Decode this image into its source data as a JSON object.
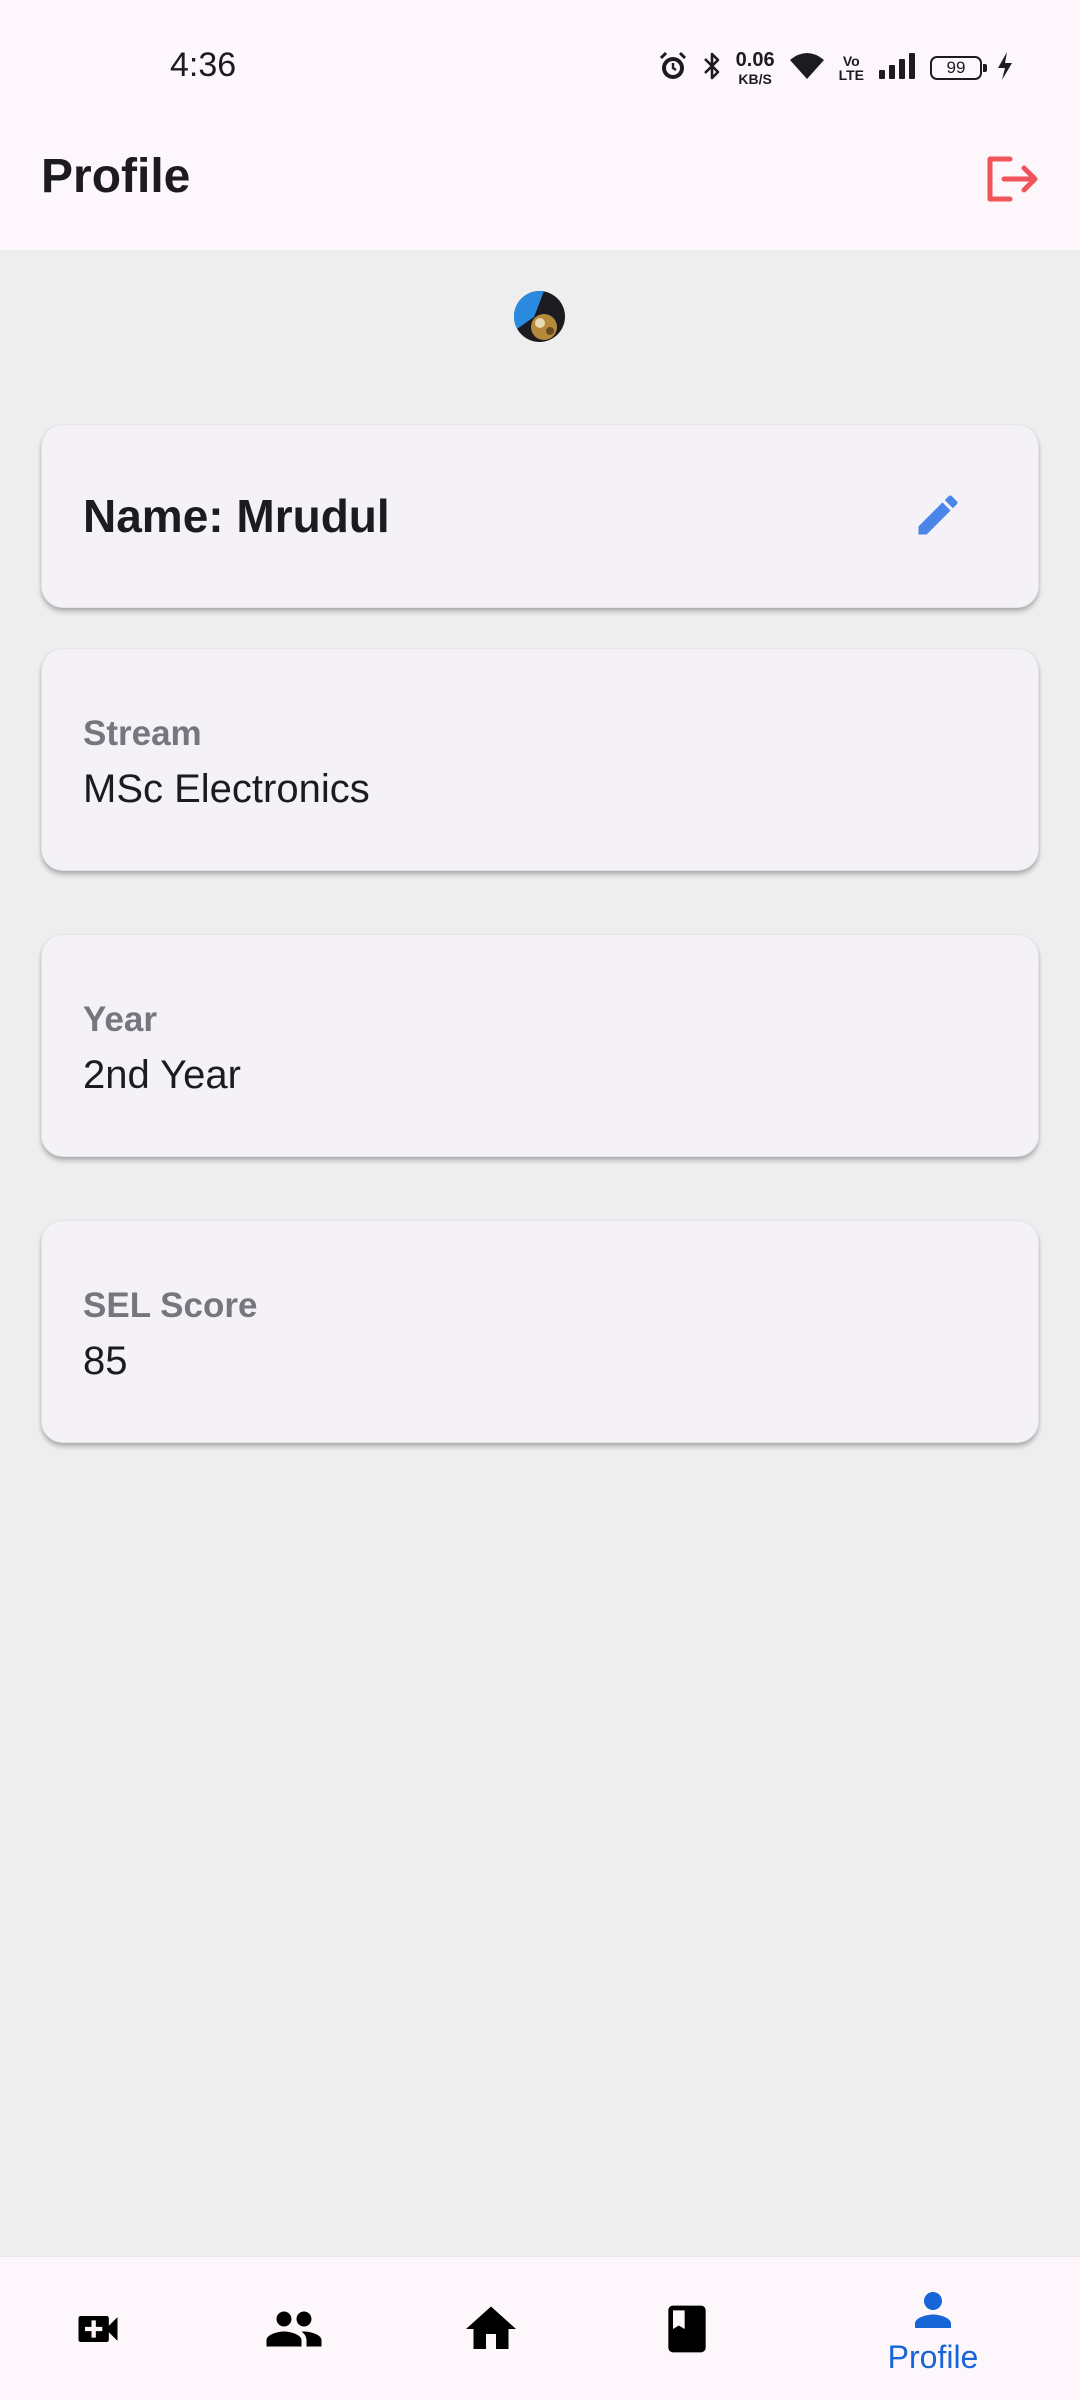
{
  "status_bar": {
    "time": "4:36",
    "net_speed_value": "0.06",
    "net_speed_unit": "KB/S",
    "volte_top": "Vo",
    "volte_bottom": "LTE",
    "battery_level": "99",
    "icons": [
      "alarm-icon",
      "bluetooth-icon",
      "wifi-icon",
      "signal-icon",
      "battery-icon",
      "charging-icon"
    ]
  },
  "app_bar": {
    "title": "Profile",
    "logout_icon": "logout-icon"
  },
  "profile": {
    "name_text": "Name: Mrudul",
    "edit_icon": "edit-pencil-icon",
    "fields": [
      {
        "label": "Stream",
        "value": "MSc Electronics"
      },
      {
        "label": "Year",
        "value": "2nd Year"
      },
      {
        "label": "SEL Score",
        "value": "85"
      }
    ]
  },
  "bottom_nav": {
    "items": [
      {
        "icon": "video-call-icon"
      },
      {
        "icon": "people-icon"
      },
      {
        "icon": "home-icon"
      },
      {
        "icon": "book-icon"
      },
      {
        "icon": "person-icon",
        "label": "Profile",
        "active": true
      }
    ]
  },
  "colors": {
    "background": "#eeeeee",
    "bar_background": "#fdf7fc",
    "card_background": "#f4f2f7",
    "accent_blue": "#1765d6",
    "edit_blue": "#4a86e8",
    "logout_red": "#f0535a",
    "label_gray": "#77757d"
  }
}
